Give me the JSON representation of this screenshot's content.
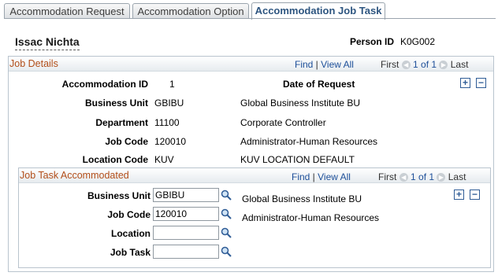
{
  "tabs": [
    {
      "label": "Accommodation Request"
    },
    {
      "label": "Accommodation Option"
    },
    {
      "label": "Accommodation Job Task"
    }
  ],
  "person": {
    "name": "Issac Nichta",
    "id_label": "Person ID",
    "id_value": "K0G002"
  },
  "job_details": {
    "title": "Job Details",
    "nav": {
      "find": "Find",
      "view_all": "View All",
      "first": "First",
      "range": "1 of 1",
      "last": "Last"
    },
    "accommodation_id_label": "Accommodation ID",
    "accommodation_id_value": "1",
    "date_of_request_label": "Date of Request",
    "rows": [
      {
        "label": "Business Unit",
        "code": "GBIBU",
        "desc": "Global Business Institute BU"
      },
      {
        "label": "Department",
        "code": "11100",
        "desc": "Corporate Controller"
      },
      {
        "label": "Job Code",
        "code": "120010",
        "desc": "Administrator-Human Resources"
      },
      {
        "label": "Location Code",
        "code": "KUV",
        "desc": "KUV LOCATION DEFAULT"
      }
    ]
  },
  "job_task": {
    "title": "Job Task Accommodated",
    "nav": {
      "find": "Find",
      "view_all": "View All",
      "first": "First",
      "range": "1 of 1",
      "last": "Last"
    },
    "fields": [
      {
        "label": "Business Unit",
        "value": "GBIBU",
        "desc": "Global Business Institute BU"
      },
      {
        "label": "Job Code",
        "value": "120010",
        "desc": "Administrator-Human Resources"
      },
      {
        "label": "Location",
        "value": "",
        "desc": ""
      },
      {
        "label": "Job Task",
        "value": "",
        "desc": ""
      }
    ]
  },
  "icons": {
    "add": "+",
    "delete": "−",
    "prev": "◀",
    "next": "▶"
  }
}
